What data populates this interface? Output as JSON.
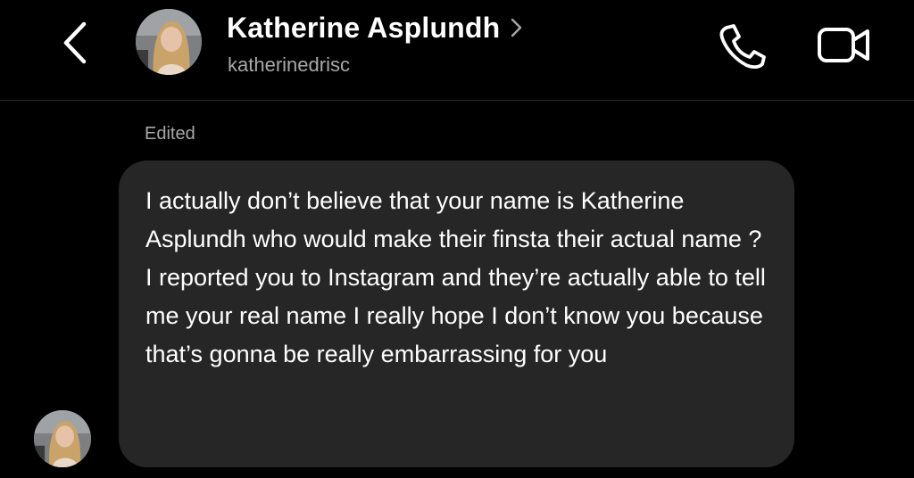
{
  "header": {
    "contact_name": "Katherine Asplundh",
    "username": "katherinedrisc",
    "icons": {
      "back": "chevron-left-icon",
      "profile": "chevron-right-icon",
      "call": "phone-icon",
      "video": "video-camera-icon"
    }
  },
  "thread": {
    "edited_label": "Edited",
    "messages": [
      {
        "sender": "Katherine Asplundh",
        "edited": true,
        "text": "I actually don’t believe that your name is Katherine Asplundh who would make their finsta their actual name ? I reported you to Instagram and they’re actually able to tell me your real name I really hope I don’t know you because that’s gonna be really embarrassing for you"
      }
    ]
  },
  "colors": {
    "background": "#000000",
    "bubble": "#262626",
    "secondary_text": "#a8a8a8",
    "divider": "#262626"
  }
}
